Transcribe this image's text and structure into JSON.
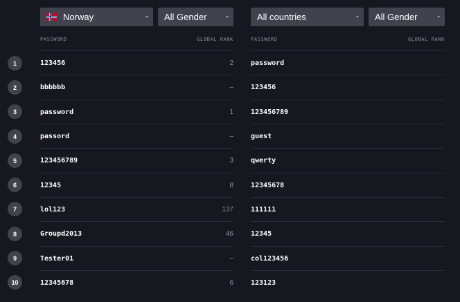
{
  "left": {
    "country": "Norway",
    "gender": "All Gender",
    "col_password": "PASSWORD",
    "col_rank": "GLOBAL RANK",
    "rows": [
      {
        "password": "123456",
        "rank": "2"
      },
      {
        "password": "bbbbbb",
        "rank": "–"
      },
      {
        "password": "password",
        "rank": "1"
      },
      {
        "password": "passord",
        "rank": "–"
      },
      {
        "password": "123456789",
        "rank": "3"
      },
      {
        "password": "12345",
        "rank": "8"
      },
      {
        "password": "lol123",
        "rank": "137"
      },
      {
        "password": "Groupd2013",
        "rank": "46"
      },
      {
        "password": "Tester01",
        "rank": "–"
      },
      {
        "password": "12345678",
        "rank": "6"
      }
    ]
  },
  "right": {
    "country": "All countries",
    "gender": "All Gender",
    "col_password": "PASSWORD",
    "col_rank": "GLOBAL RANK",
    "rows": [
      {
        "password": "password"
      },
      {
        "password": "123456"
      },
      {
        "password": "123456789"
      },
      {
        "password": "guest"
      },
      {
        "password": "qwerty"
      },
      {
        "password": "12345678"
      },
      {
        "password": "111111"
      },
      {
        "password": "12345"
      },
      {
        "password": "col123456"
      },
      {
        "password": "123123"
      }
    ]
  },
  "ranks": [
    "1",
    "2",
    "3",
    "4",
    "5",
    "6",
    "7",
    "8",
    "9",
    "10"
  ],
  "colors": {
    "background": "#16181f",
    "control": "#40434e",
    "muted_text": "#8b8e98",
    "divider": "#2b2e37"
  },
  "icons": {
    "flag": "norway-flag-icon",
    "caret": "caret-down-icon"
  }
}
